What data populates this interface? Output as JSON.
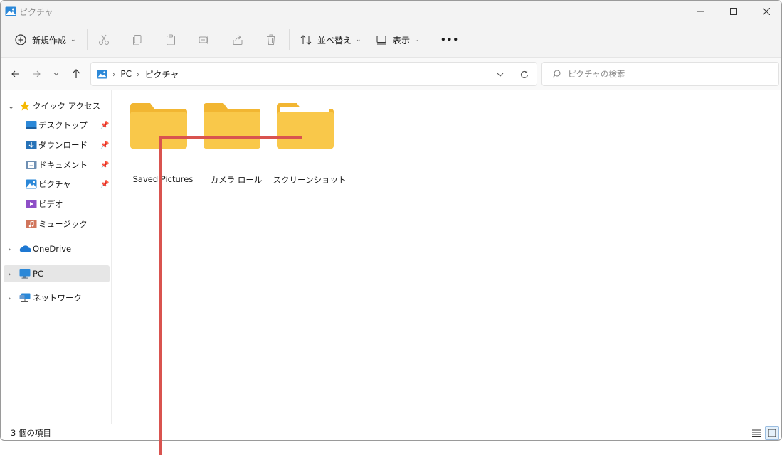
{
  "window": {
    "title": "ピクチャ",
    "controls": [
      "minimize",
      "maximize",
      "close"
    ]
  },
  "toolbar": {
    "new_label": "新規作成",
    "sort_label": "並べ替え",
    "view_label": "表示",
    "more_label": "•••"
  },
  "address": {
    "crumbs": [
      "PC",
      "ピクチャ"
    ]
  },
  "search": {
    "placeholder": "ピクチャの検索"
  },
  "sidebar": {
    "quick_access": "クイック アクセス",
    "items": [
      {
        "label": "デスクトップ",
        "icon": "desktop-icon",
        "pinned": true
      },
      {
        "label": "ダウンロード",
        "icon": "downloads-icon",
        "pinned": true
      },
      {
        "label": "ドキュメント",
        "icon": "documents-icon",
        "pinned": true
      },
      {
        "label": "ピクチャ",
        "icon": "pictures-icon",
        "pinned": true
      },
      {
        "label": "ビデオ",
        "icon": "videos-icon",
        "pinned": false
      },
      {
        "label": "ミュージック",
        "icon": "music-icon",
        "pinned": false
      }
    ],
    "onedrive": "OneDrive",
    "pc": "PC",
    "network": "ネットワーク"
  },
  "folders": [
    {
      "label": "Saved Pictures"
    },
    {
      "label": "カメラ ロール"
    },
    {
      "label": "スクリーンショット"
    }
  ],
  "status": {
    "item_count": "3 個の項目"
  },
  "colors": {
    "folder": "#f9c84a",
    "folder_back": "#f2b632",
    "annotation": "#d9534f",
    "selected_bg": "#e6e6e6"
  }
}
